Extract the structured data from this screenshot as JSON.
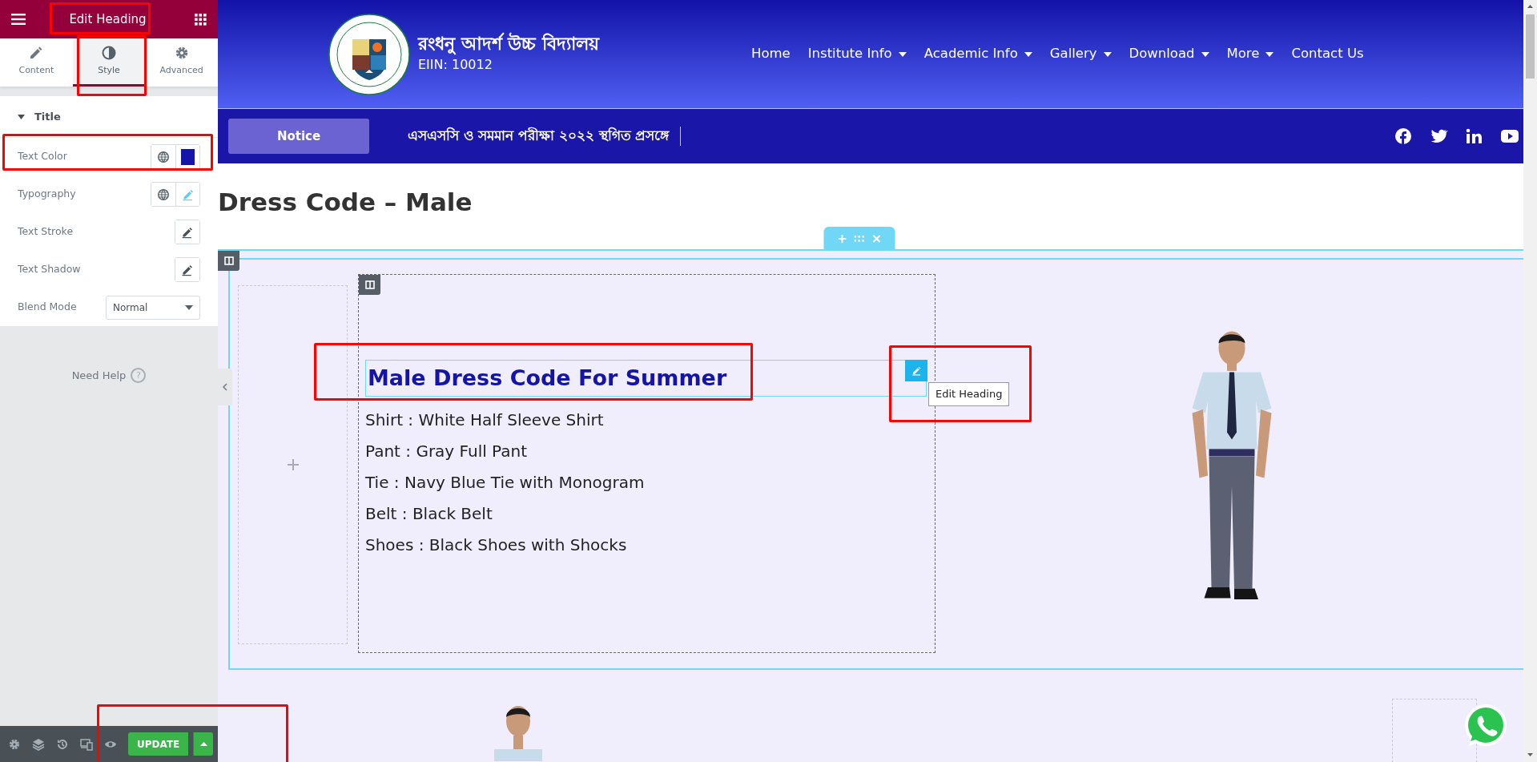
{
  "editor": {
    "title": "Edit Heading",
    "tabs": [
      {
        "label": "Content",
        "kind": "content",
        "selected": false
      },
      {
        "label": "Style",
        "kind": "style",
        "selected": true
      },
      {
        "label": "Advanced",
        "kind": "advanced",
        "selected": false
      }
    ],
    "section": {
      "title": "Title",
      "expanded": true
    },
    "controls": [
      {
        "kind": "color",
        "label": "Text Color",
        "color": "#1414a8"
      },
      {
        "kind": "typography",
        "label": "Typography"
      },
      {
        "kind": "edit",
        "label": "Text Stroke"
      },
      {
        "kind": "edit",
        "label": "Text Shadow"
      },
      {
        "kind": "select",
        "label": "Blend Mode",
        "value": "Normal"
      }
    ],
    "help": "Need Help",
    "help_mark": "?",
    "update_button": "UPDATE"
  },
  "site": {
    "school_name": "রংধনু আদর্শ উচ্চ বিদ্যালয়",
    "eiin": "EIIN: 10012",
    "nav": [
      {
        "label": "Home",
        "dropdown": false
      },
      {
        "label": "Institute Info",
        "dropdown": true
      },
      {
        "label": "Academic Info",
        "dropdown": true
      },
      {
        "label": "Gallery",
        "dropdown": true
      },
      {
        "label": "Download",
        "dropdown": true
      },
      {
        "label": "More",
        "dropdown": true
      },
      {
        "label": "Contact Us",
        "dropdown": false
      }
    ],
    "notice_label": "Notice",
    "notice_text": "এসএসসি ও সমমান পরীক্ষা ২০২২ স্থগিত প্রসঙ্গে"
  },
  "page": {
    "title": "Dress Code – Male",
    "heading": "Male Dress Code For Summer",
    "tooltip": "Edit Heading",
    "items": [
      "Shirt : White Half Sleeve Shirt",
      "Pant : Gray Full Pant",
      "Tie : Navy Blue Tie with Monogram",
      "Belt : Black Belt",
      "Shoes : Black Shoes with Shocks"
    ]
  }
}
